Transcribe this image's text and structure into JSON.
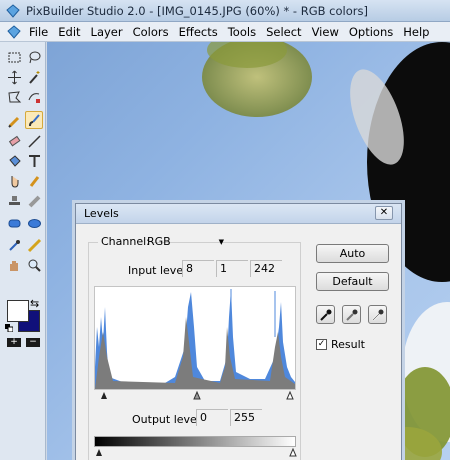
{
  "window": {
    "title": "PixBuilder Studio 2.0 - [IMG_0145.JPG (60%) * - RGB colors]"
  },
  "menu": [
    "File",
    "Edit",
    "Layer",
    "Colors",
    "Effects",
    "Tools",
    "Select",
    "View",
    "Options",
    "Help"
  ],
  "colors": {
    "foreground": "#ffffff",
    "background": "#10107a",
    "accent": "#3c6fc4"
  },
  "toolbox": {
    "tools": [
      "rect-select-icon",
      "lasso-icon",
      "move-icon",
      "magic-wand-icon",
      "polygon-lasso-icon",
      "magnetic-lasso-icon",
      "pencil-icon",
      "brush-icon",
      "eraser-icon",
      "line-icon",
      "bucket-icon",
      "text-icon",
      "smudge-icon",
      "clone-icon",
      "stamp-icon",
      "gradient-icon",
      "rect-shape-icon",
      "ellipse-shape-icon",
      "eyedropper-icon",
      "measure-icon",
      "hand-icon",
      "zoom-icon"
    ],
    "add_label": "+",
    "remove_label": "−"
  },
  "levels": {
    "title": "Levels",
    "close": "✕",
    "channel_label": "Channel:",
    "channel_value": "RGB",
    "input_label": "Input levels:",
    "input_black": "8",
    "input_gamma": "1",
    "input_white": "242",
    "output_label": "Output levels:",
    "output_black": "0",
    "output_white": "255",
    "buttons": {
      "auto": "Auto",
      "default": "Default"
    },
    "result_label": "Result",
    "result_checked": true
  }
}
